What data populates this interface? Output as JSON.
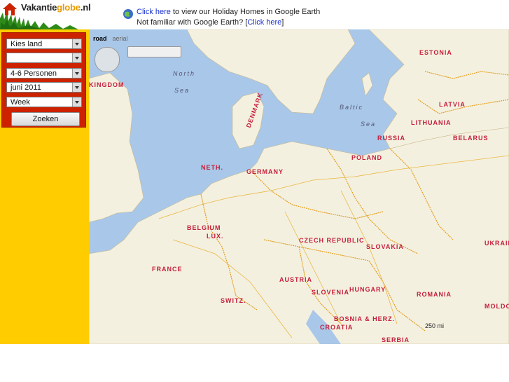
{
  "logo": {
    "part1": "Vakantie",
    "part2": "globe",
    "part3": ".nl"
  },
  "earth_message": {
    "link1": "Click here",
    "text1": " to view our Holiday Homes in Google Earth",
    "text2": "Not familiar with Google Earth? [",
    "link2": "Click here",
    "text3": "]"
  },
  "search_form": {
    "country": "Kies land",
    "region": "",
    "persons": "4-6 Personen",
    "month": "juni 2011",
    "duration": "Week",
    "submit_label": "Zoeken"
  },
  "map": {
    "tabs": [
      "road",
      "aerial"
    ],
    "scale": "250 mi",
    "countries": [
      "KINGDOM",
      "NETH.",
      "GERMANY",
      "BELGIUM",
      "LUX.",
      "FRANCE",
      "SWITZ.",
      "AUSTRIA",
      "CZECH REPUBLIC",
      "POLAND",
      "SLOVAKIA",
      "HUNGARY",
      "SLOVENIA",
      "CROATIA",
      "BOSNIA & HERZ.",
      "SERBIA",
      "ROMANIA",
      "UKRAINE",
      "BELARUS",
      "LITHUANIA",
      "LATVIA",
      "ESTONIA",
      "RUSSIA",
      "DENMARK",
      "MOLDOVA"
    ],
    "seas": [
      "North",
      "Sea",
      "Baltic",
      "Sea"
    ],
    "colors": {
      "land": "#f4f0e0",
      "water": "#a9c7e8",
      "border": "#e0a020",
      "accent": "#cc2200",
      "sidebar": "#ffcc00"
    }
  }
}
